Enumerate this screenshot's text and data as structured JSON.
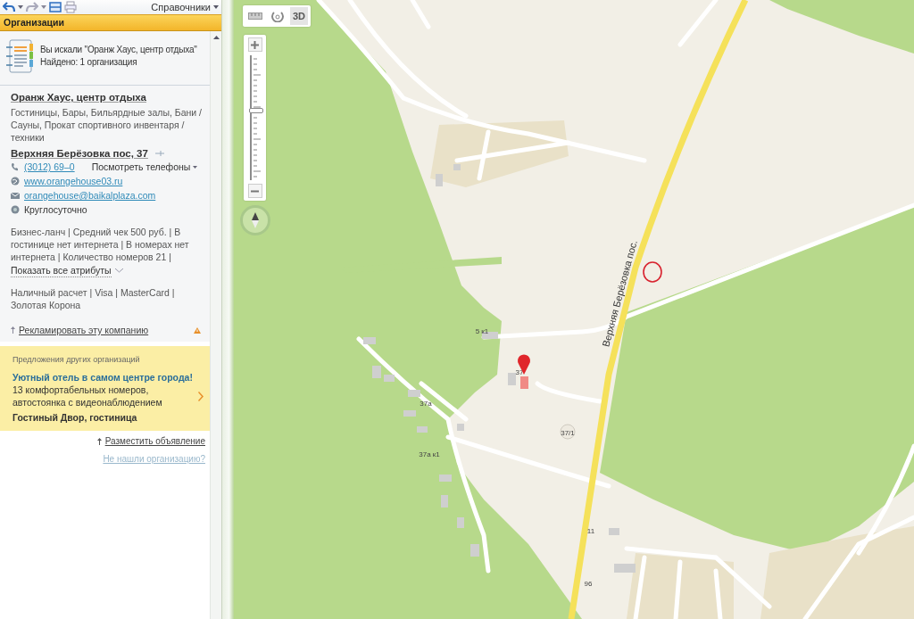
{
  "toolbar": {
    "directories_menu": "Справочники"
  },
  "panel": {
    "title": "Организации"
  },
  "search_summary": {
    "query": "Вы искали \"Оранж Хаус, центр отдыха\"",
    "found": "Найдено: 1 организация"
  },
  "organization": {
    "name": "Оранж Хаус, центр отдыха",
    "categories": "Гостиницы, Бары, Бильярдные залы, Бани / Сауны, Прокат спортивного инвентаря / техники",
    "address": "Верхняя Берёзовка пос, 37",
    "contacts": [
      {
        "kind": "phone",
        "text": "(3012) 69–0",
        "extra": "Посмотреть телефоны"
      },
      {
        "kind": "web",
        "text": "www.orangehouse03.ru"
      },
      {
        "kind": "email",
        "text": "orangehouse@baikalplaza.com"
      },
      {
        "kind": "hours",
        "text": "Круглосуточно"
      }
    ],
    "attributes": "Бизнес-ланч | Средний чек 500 руб. | В гостинице нет интернета | В номерах нет интернета | Количество номеров 21 |",
    "show_all_attributes": "Показать все атрибуты",
    "payments": "Наличный расчет | Visa | MasterCard | Золотая Корона",
    "advertise_link": "Рекламировать эту компанию"
  },
  "ads": {
    "heading": "Предложения других организаций",
    "title": "Уютный отель в самом центре города!",
    "text": "13 комфортабельных номеров, автостоянка с видеонаблюдением",
    "company": "Гостиный Двор, гостиница"
  },
  "footer_links": [
    "Разместить объявление",
    "Не нашли организацию?"
  ],
  "map": {
    "toolbar": [
      {
        "kind": "ruler",
        "selected": false
      },
      {
        "kind": "traffic",
        "selected": false
      },
      {
        "kind": "perspective",
        "label": "3D",
        "selected": true
      }
    ],
    "zoom": {
      "level": 0.56
    },
    "labels": [
      {
        "kind": "street",
        "text": "Верхняя Берёзовка пос."
      },
      {
        "kind": "house",
        "text": "5 к1"
      },
      {
        "kind": "house",
        "text": "37"
      },
      {
        "kind": "house",
        "text": "37а"
      },
      {
        "kind": "house",
        "text": "37а к1"
      },
      {
        "kind": "circle",
        "text": "37/1"
      },
      {
        "kind": "house",
        "text": "11"
      },
      {
        "kind": "house",
        "text": "96"
      }
    ]
  }
}
